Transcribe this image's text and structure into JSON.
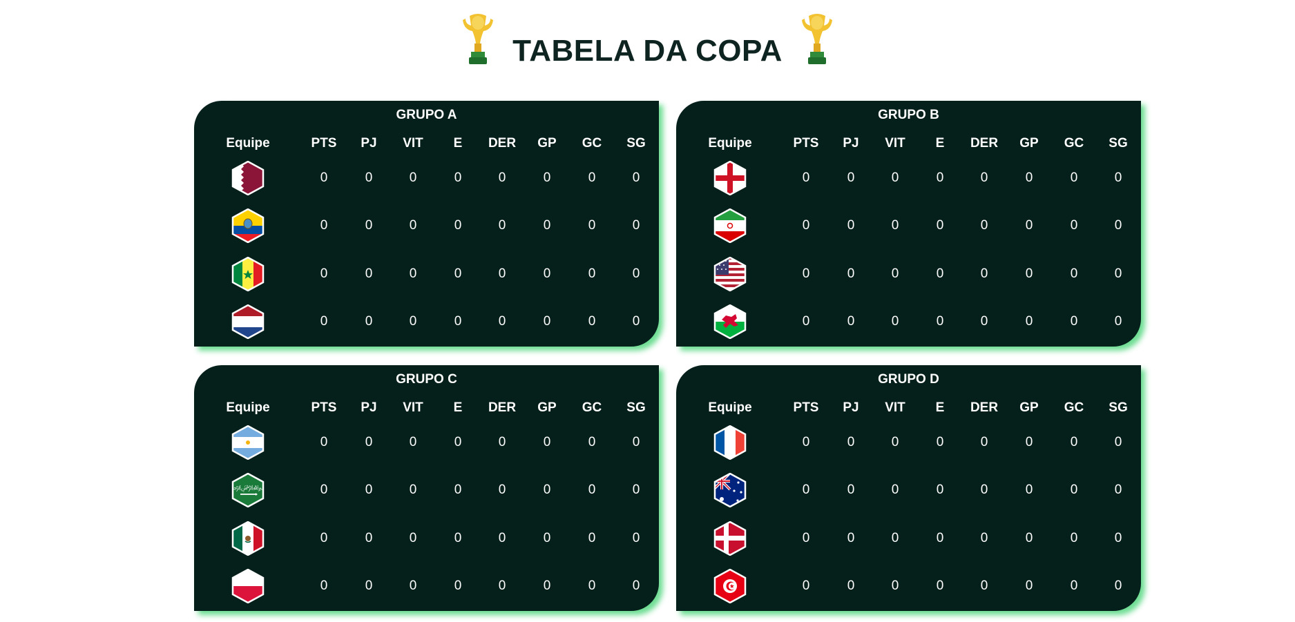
{
  "page": {
    "title": "TABELA DA COPA"
  },
  "columns": [
    "Equipe",
    "PTS",
    "PJ",
    "VIT",
    "E",
    "DER",
    "GP",
    "GC",
    "SG"
  ],
  "groups": [
    {
      "name": "GRUPO A",
      "teams": [
        {
          "flag": "qatar-flag-icon",
          "stats": [
            "0",
            "0",
            "0",
            "0",
            "0",
            "0",
            "0",
            "0"
          ]
        },
        {
          "flag": "ecuador-flag-icon",
          "stats": [
            "0",
            "0",
            "0",
            "0",
            "0",
            "0",
            "0",
            "0"
          ]
        },
        {
          "flag": "senegal-flag-icon",
          "stats": [
            "0",
            "0",
            "0",
            "0",
            "0",
            "0",
            "0",
            "0"
          ]
        },
        {
          "flag": "netherlands-flag-icon",
          "stats": [
            "0",
            "0",
            "0",
            "0",
            "0",
            "0",
            "0",
            "0"
          ]
        }
      ]
    },
    {
      "name": "GRUPO B",
      "teams": [
        {
          "flag": "england-flag-icon",
          "stats": [
            "0",
            "0",
            "0",
            "0",
            "0",
            "0",
            "0",
            "0"
          ]
        },
        {
          "flag": "iran-flag-icon",
          "stats": [
            "0",
            "0",
            "0",
            "0",
            "0",
            "0",
            "0",
            "0"
          ]
        },
        {
          "flag": "usa-flag-icon",
          "stats": [
            "0",
            "0",
            "0",
            "0",
            "0",
            "0",
            "0",
            "0"
          ]
        },
        {
          "flag": "wales-flag-icon",
          "stats": [
            "0",
            "0",
            "0",
            "0",
            "0",
            "0",
            "0",
            "0"
          ]
        }
      ]
    },
    {
      "name": "GRUPO C",
      "teams": [
        {
          "flag": "argentina-flag-icon",
          "stats": [
            "0",
            "0",
            "0",
            "0",
            "0",
            "0",
            "0",
            "0"
          ]
        },
        {
          "flag": "saudi-arabia-flag-icon",
          "stats": [
            "0",
            "0",
            "0",
            "0",
            "0",
            "0",
            "0",
            "0"
          ]
        },
        {
          "flag": "mexico-flag-icon",
          "stats": [
            "0",
            "0",
            "0",
            "0",
            "0",
            "0",
            "0",
            "0"
          ]
        },
        {
          "flag": "poland-flag-icon",
          "stats": [
            "0",
            "0",
            "0",
            "0",
            "0",
            "0",
            "0",
            "0"
          ]
        }
      ]
    },
    {
      "name": "GRUPO D",
      "teams": [
        {
          "flag": "france-flag-icon",
          "stats": [
            "0",
            "0",
            "0",
            "0",
            "0",
            "0",
            "0",
            "0"
          ]
        },
        {
          "flag": "australia-flag-icon",
          "stats": [
            "0",
            "0",
            "0",
            "0",
            "0",
            "0",
            "0",
            "0"
          ]
        },
        {
          "flag": "denmark-flag-icon",
          "stats": [
            "0",
            "0",
            "0",
            "0",
            "0",
            "0",
            "0",
            "0"
          ]
        },
        {
          "flag": "tunisia-flag-icon",
          "stats": [
            "0",
            "0",
            "0",
            "0",
            "0",
            "0",
            "0",
            "0"
          ]
        }
      ]
    }
  ],
  "colors": {
    "card_bg": "#051f1a",
    "glow": "#3cd26e",
    "title": "#0e2420"
  }
}
